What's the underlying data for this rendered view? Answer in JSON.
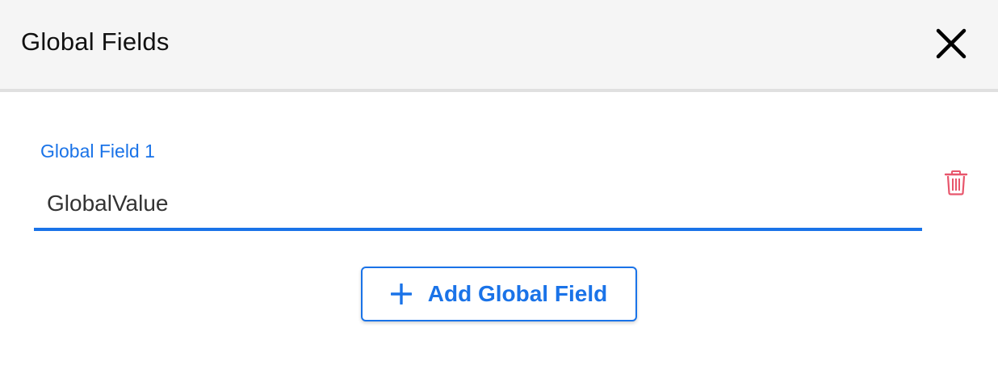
{
  "dialog": {
    "title": "Global Fields",
    "close_icon": "close-icon"
  },
  "fields": [
    {
      "label": "Global Field 1",
      "value": "GlobalValue",
      "delete_icon": "trash-icon"
    }
  ],
  "add_button": {
    "label": "Add Global Field",
    "icon": "plus-icon"
  },
  "colors": {
    "accent": "#1a73e8",
    "danger": "#e8566c",
    "header_bg": "#f5f5f5"
  }
}
